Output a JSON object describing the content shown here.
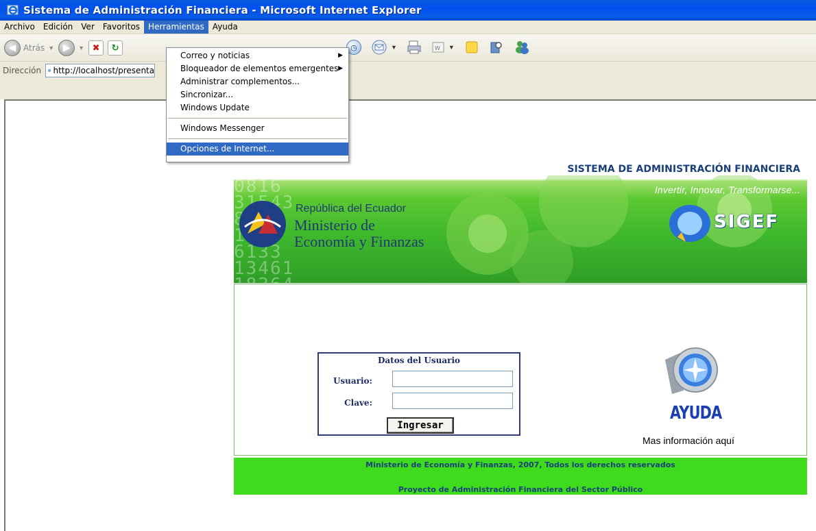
{
  "window": {
    "title": "Sistema de Administración Financiera - Microsoft Internet Explorer"
  },
  "menubar": {
    "items": [
      "Archivo",
      "Edición",
      "Ver",
      "Favoritos",
      "Herramientas",
      "Ayuda"
    ]
  },
  "toolbar": {
    "back_label": "Atrás"
  },
  "addressbar": {
    "label": "Dirección",
    "url": "http://localhost/presenta"
  },
  "tools_menu": {
    "items": [
      {
        "label": "Correo y noticias",
        "submenu": true
      },
      {
        "label": "Bloqueador de elementos emergentes",
        "submenu": true
      },
      {
        "label": "Administrar complementos...",
        "submenu": false
      },
      {
        "label": "Sincronizar...",
        "submenu": false
      },
      {
        "label": "Windows Update",
        "submenu": false
      },
      {
        "label": "Windows Messenger",
        "submenu": false
      },
      {
        "label": "Opciones de Internet...",
        "submenu": false
      }
    ]
  },
  "banner": {
    "system_title": "SISTEMA DE ADMINISTRACIÓN FINANCIERA",
    "slogan": "Invertir, Innovar, Transformarse...",
    "republica": "República del Ecuador",
    "ministerio_line1": "Ministerio de",
    "ministerio_line2": "Economía y Finanzas",
    "sigef_text": "SIGEF"
  },
  "login": {
    "title": "Datos del Usuario",
    "user_label": "Usuario:",
    "password_label": "Clave:",
    "user_value": "",
    "password_value": "",
    "submit_label": "Ingresar"
  },
  "help": {
    "title": "AYUDA",
    "subtitle": "Mas información aquí"
  },
  "footer": {
    "line1": "Ministerio de Economía y Finanzas, 2007, Todos los derechos reservados",
    "line2": "Proyecto de Administración Financiera del Sector Público"
  },
  "colors": {
    "titlebar_blue": "#0050ee",
    "menu_highlight": "#316ac5",
    "banner_green": "#3fb82d",
    "footer_green": "#3fdc1e",
    "navy_text": "#1a3f7a"
  }
}
